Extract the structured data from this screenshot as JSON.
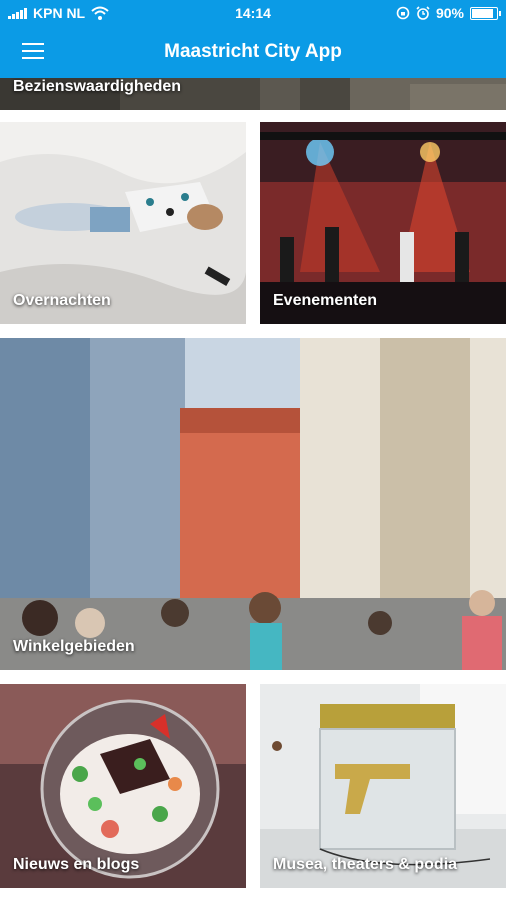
{
  "status_bar": {
    "carrier": "KPN NL",
    "time": "14:14",
    "battery_percent": "90%",
    "battery_level": 0.9,
    "icons": [
      "signal-icon",
      "wifi-icon",
      "rotation-lock-icon",
      "alarm-icon",
      "battery-icon"
    ]
  },
  "app_bar": {
    "title": "Maastricht City App",
    "menu_icon": "hamburger-menu-icon"
  },
  "colors": {
    "accent": "#0b9be6"
  },
  "tiles": [
    {
      "label": "Bezienswaardigheden"
    },
    {
      "label": "Overnachten"
    },
    {
      "label": "Evenementen"
    },
    {
      "label": "Winkelgebieden"
    },
    {
      "label": "Nieuws en blogs"
    },
    {
      "label": "Musea, theaters & podia"
    }
  ]
}
